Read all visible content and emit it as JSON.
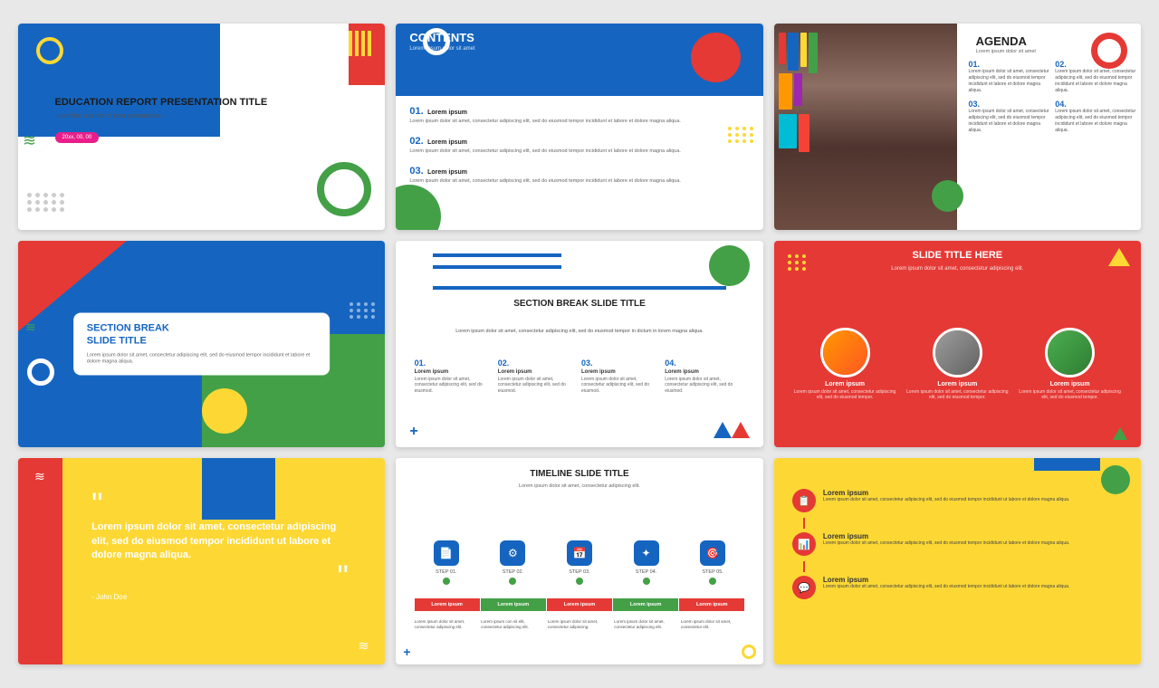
{
  "slides": [
    {
      "id": "slide1",
      "title": "EDUCATION REPORT\nPRESENTATION TITLE",
      "subtitle": "Insert the sub title of your presentation",
      "button": "20xx, 00, 00"
    },
    {
      "id": "slide2",
      "heading": "CONTENTS",
      "subheading": "Lorem ipsum dolor sit amet",
      "items": [
        {
          "num": "01.",
          "title": "Lorem ipsum",
          "text": "Lorem ipsum dolor sit amet, consectetur adipiscing elit, sed do eiusmod tempor incididunt et labore et dolore magna aliqua."
        },
        {
          "num": "02.",
          "title": "Lorem ipsum",
          "text": "Lorem ipsum dolor sit amet, consectetur adipiscing elit, sed do eiusmod tempor incididunt et labore et dolore magna aliqua."
        },
        {
          "num": "03.",
          "title": "Lorem ipsum",
          "text": "Lorem ipsum dolor sit amet, consectetur adipiscing elit, sed do eiusmod tempor incididunt et labore et dolore magna aliqua."
        }
      ]
    },
    {
      "id": "slide3",
      "heading": "AGENDA",
      "subheading": "Lorem ipsum dolor sit amet",
      "items": [
        {
          "num": "01.",
          "text": "Lorem ipsum dolor sit amet, consectetur adipiscing elit, sed do eiusmod tempor incididunt et labore et dolore magna aliqua."
        },
        {
          "num": "02.",
          "text": "Lorem ipsum dolor sit amet, consectetur adipiscing elit, sed do eiusmod tempor incididunt et labore et dolore magna aliqua."
        },
        {
          "num": "03.",
          "text": "Lorem ipsum dolor sit amet, consectetur adipiscing elit, sed do eiusmod tempor incididunt et labore et dolore magna aliqua."
        },
        {
          "num": "04.",
          "text": "Lorem ipsum dolor sit amet, consectetur adipiscing elit, sed do eiusmod tempor incididunt et labore et dolore magna aliqua."
        }
      ]
    },
    {
      "id": "slide4",
      "title": "SECTION BREAK\nSLIDE TITLE",
      "text": "Lorem ipsum dolor sit amet, consectetur adipiscing elit, sed do eiusmod tempor incididunt et labore et dolore magna aliqua."
    },
    {
      "id": "slide5",
      "title": "SECTION BREAK SLIDE TITLE",
      "subtitle": "Lorem ipsum dolor sit amet, consectetur adipiscing elit, sed do eiusmod\ntempor in dictum in lorem magna aliqua.",
      "items": [
        {
          "num": "01.",
          "label": "Lorem ipsum",
          "text": "Lorem ipsum dolor sit amet, consectetur adipiscing elit, sed do eiusmod tempor in lorem magna."
        },
        {
          "num": "02.",
          "label": "Lorem ipsum",
          "text": "Lorem ipsum dolor sit amet, consectetur adipiscing elit, sed do eiusmod tempor in lorem magna."
        },
        {
          "num": "03.",
          "label": "Lorem ipsum",
          "text": "Lorem ipsum dolor sit amet, consectetur adipiscing elit, sed do eiusmod tempor in lorem magna."
        },
        {
          "num": "04.",
          "label": "Lorem ipsum",
          "text": "Lorem ipsum dolor sit amet, consectetur adipiscing elit, sed do eiusmod tempor in lorem magna."
        }
      ]
    },
    {
      "id": "slide6",
      "title": "SLIDE TITLE HERE",
      "subtitle": "Lorem ipsum dolor sit amet, consectetur adipiscing elit.",
      "people": [
        {
          "label": "Lorem ipsum",
          "text": "Lorem ipsum dolor sit amet, consectetur adipiscing elit, sed do eiusmod tempor incididunt ut labore et dolore magna aliqua."
        },
        {
          "label": "Lorem ipsum",
          "text": "Lorem ipsum dolor sit amet, consectetur adipiscing elit, sed do eiusmod tempor incididunt ut labore et dolore magna aliqua."
        },
        {
          "label": "Lorem ipsum",
          "text": "Lorem ipsum dolor sit amet, consectetur adipiscing elit, sed do eiusmod tempor incididunt ut labore et dolore magna aliqua."
        }
      ]
    },
    {
      "id": "slide7",
      "quote": "Lorem ipsum dolor sit amet, consectetur adipiscing elit, sed do eiusmod tempor incididunt ut labore et dolore magna aliqua.",
      "author": "- John Doe"
    },
    {
      "id": "slide8",
      "title": "TIMELINE SLIDE TITLE",
      "subtitle": "Lorem ipsum dolor sit amet, consectetur adipiscing elit.",
      "steps": [
        {
          "label": "STEP 01.",
          "pill": "Lorem ipsum",
          "text": "Lorem ipsum dolor sit amet, consectetur adipiscing elit."
        },
        {
          "label": "STEP 02.",
          "pill": "Lorem ipsum",
          "text": "Lorem ipsum con sit elit, consectetur adipiscing elit."
        },
        {
          "label": "STEP 03.",
          "pill": "Lorem ipsum",
          "text": "Lorem ipsum dolor sit amet, consectetur adipiscing."
        },
        {
          "label": "STEP 04.",
          "pill": "Lorem ipsum",
          "text": "Lorem ipsum dolor sit amet, consectetur adipiscing elit."
        },
        {
          "label": "STEP 05.",
          "pill": "Lorem ipsum",
          "text": "Lorem ipsum dolor sit amet, consectetur elit."
        }
      ]
    },
    {
      "id": "slide9",
      "items": [
        {
          "icon": "📋",
          "title": "Lorem ipsum",
          "text": "Lorem ipsum dolor sit amet, consectetur adipiscing elit, sed do eiusmod tempor incididunt ut labore et dolore magna aliqua."
        },
        {
          "icon": "📊",
          "title": "Lorem ipsum",
          "text": "Lorem ipsum dolor sit amet, consectetur adipiscing elit, sed do eiusmod tempor incididunt ut labore et dolore magna aliqua."
        },
        {
          "icon": "💬",
          "title": "Lorem ipsum",
          "text": "Lorem ipsum dolor sit amet, consectetur adipiscing elit, sed do eiusmod tempor incididunt ut labore et dolore magna aliqua."
        }
      ]
    }
  ],
  "colors": {
    "blue": "#1565C0",
    "red": "#E53935",
    "green": "#43A047",
    "yellow": "#FDD835",
    "pink": "#E91E8C"
  }
}
